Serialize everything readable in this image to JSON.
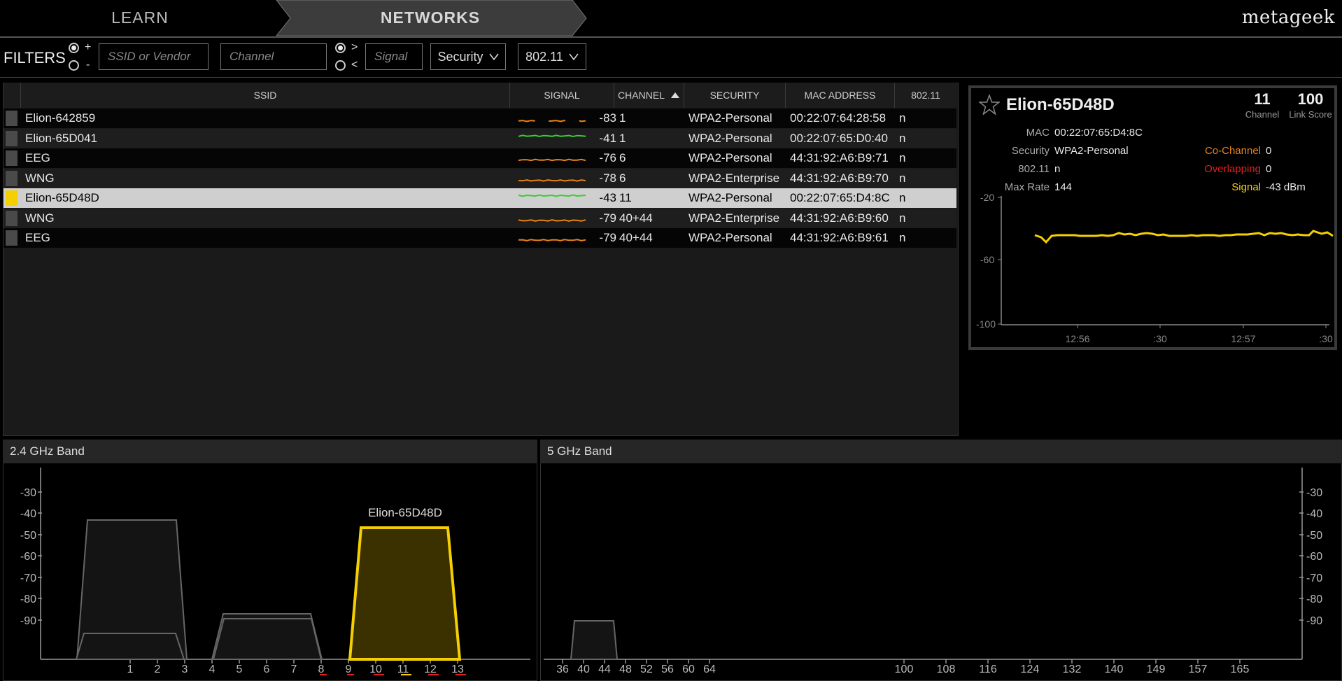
{
  "app": {
    "logo": "metageek"
  },
  "nav": {
    "tabs": [
      {
        "label": "LEARN"
      },
      {
        "label": "NETWORKS"
      }
    ]
  },
  "filters": {
    "label": "FILTERS",
    "include_label": "+",
    "exclude_label": "-",
    "ssid_placeholder": "SSID or Vendor",
    "channel_placeholder": "Channel",
    "gt_label": ">",
    "lt_label": "<",
    "signal_placeholder": "Signal",
    "security_label": "Security",
    "standard_label": "802.11"
  },
  "table": {
    "columns": [
      "SSID",
      "SIGNAL",
      "CHANNEL",
      "SECURITY",
      "MAC ADDRESS",
      "802.11"
    ],
    "rows": [
      {
        "ssid": "Elion-642859",
        "signal": "-83",
        "channel": "1",
        "security": "WPA2-Personal",
        "mac": "00:22:07:64:28:58",
        "std": "n",
        "color": "#e8821a"
      },
      {
        "ssid": "Elion-65D041",
        "signal": "-41",
        "channel": "1",
        "security": "WPA2-Personal",
        "mac": "00:22:07:65:D0:40",
        "std": "n",
        "color": "#35d12e"
      },
      {
        "ssid": "EEG",
        "signal": "-76",
        "channel": "6",
        "security": "WPA2-Personal",
        "mac": "44:31:92:A6:B9:71",
        "std": "n",
        "color": "#e8821a"
      },
      {
        "ssid": "WNG",
        "signal": "-78",
        "channel": "6",
        "security": "WPA2-Enterprise",
        "mac": "44:31:92:A6:B9:70",
        "std": "n",
        "color": "#e8821a"
      },
      {
        "ssid": "Elion-65D48D",
        "signal": "-43",
        "channel": "11",
        "security": "WPA2-Personal",
        "mac": "00:22:07:65:D4:8C",
        "std": "n",
        "color": "#35d12e",
        "selected": true
      },
      {
        "ssid": "WNG",
        "signal": "-79",
        "channel": "40+44",
        "security": "WPA2-Enterprise",
        "mac": "44:31:92:A6:B9:60",
        "std": "n",
        "color": "#e8821a"
      },
      {
        "ssid": "EEG",
        "signal": "-79",
        "channel": "40+44",
        "security": "WPA2-Personal",
        "mac": "44:31:92:A6:B9:61",
        "std": "n",
        "color": "#e8821a"
      }
    ]
  },
  "detail": {
    "name": "Elion-65D48D",
    "channel": "11",
    "channel_label": "Channel",
    "link_score": "100",
    "link_score_label": "Link Score",
    "mac_label": "MAC",
    "mac": "00:22:07:65:D4:8C",
    "security_label": "Security",
    "security": "WPA2-Personal",
    "std_label": "802.11",
    "std": "n",
    "maxrate_label": "Max Rate",
    "maxrate": "144",
    "cochannel_label": "Co-Channel",
    "cochannel": "0",
    "overlapping_label": "Overlapping",
    "overlapping": "0",
    "signal_label": "Signal",
    "signal": "-43 dBm",
    "yticks": [
      "-20",
      "-60",
      "-100"
    ],
    "xticks": [
      "12:56",
      ":30",
      "12:57",
      ":30"
    ],
    "colors": {
      "cochannel": "#e8821a",
      "overlapping": "#e02020",
      "signal": "#f5d000"
    }
  },
  "band24": {
    "title": "2.4 GHz Band",
    "yticks": [
      "-30",
      "-40",
      "-50",
      "-60",
      "-70",
      "-80",
      "-90"
    ],
    "xticks": [
      "1",
      "2",
      "3",
      "4",
      "5",
      "6",
      "7",
      "8",
      "9",
      "10",
      "11",
      "12",
      "13"
    ],
    "highlight_label": "Elion-65D48D"
  },
  "band5": {
    "title": "5 GHz Band",
    "yticks": [
      "-30",
      "-40",
      "-50",
      "-60",
      "-70",
      "-80",
      "-90"
    ],
    "xticks": [
      "36",
      "40",
      "44",
      "48",
      "52",
      "56",
      "60",
      "64",
      "100",
      "108",
      "116",
      "124",
      "132",
      "140",
      "149",
      "157",
      "165"
    ]
  }
}
